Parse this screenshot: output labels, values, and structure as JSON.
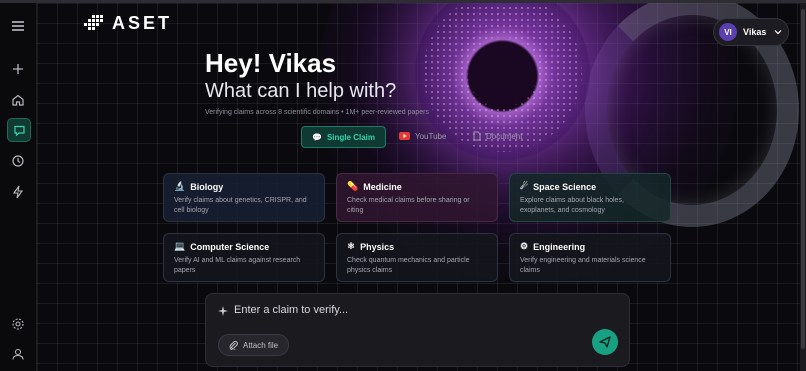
{
  "app": {
    "logo_text": "ASET"
  },
  "sidebar": {
    "items": [
      {
        "icon": "menu-icon"
      },
      {
        "icon": "plus-icon"
      },
      {
        "icon": "home-icon"
      },
      {
        "icon": "chat-icon",
        "active": true
      },
      {
        "icon": "history-icon"
      },
      {
        "icon": "lightning-icon"
      },
      {
        "icon": "settings-icon"
      },
      {
        "icon": "user-icon"
      }
    ]
  },
  "user": {
    "initials": "VI",
    "name": "Vikas"
  },
  "hero": {
    "greeting": "Hey! Vikas",
    "subtitle": "What can I help with?",
    "caption": "Verifying claims across 8 scientific domains • 1M+ peer-reviewed papers"
  },
  "modes": [
    {
      "label": "Single Claim",
      "active": true
    },
    {
      "label": "YouTube",
      "active": false
    },
    {
      "label": "Document",
      "active": false
    }
  ],
  "domains": [
    {
      "title": "Biology",
      "desc": "Verify claims about genetics, CRISPR, and cell biology",
      "emoji": "🔬"
    },
    {
      "title": "Medicine",
      "desc": "Check medical claims before sharing or citing",
      "emoji": "💊"
    },
    {
      "title": "Space Science",
      "desc": "Explore claims about black holes, exoplanets, and cosmology",
      "emoji": "☄"
    },
    {
      "title": "Computer Science",
      "desc": "Verify AI and ML claims against research papers",
      "emoji": "💻"
    },
    {
      "title": "Physics",
      "desc": "Check quantum mechanics and particle physics claims",
      "emoji": "⚛"
    },
    {
      "title": "Engineering",
      "desc": "Verify engineering and materials science claims",
      "emoji": "⚙"
    }
  ],
  "input": {
    "placeholder": "Enter a claim to verify...",
    "attach_label": "Attach file"
  },
  "colors": {
    "accent": "#18a083",
    "accent_text": "#35d4b0",
    "avatar": "#5a3fb0"
  }
}
